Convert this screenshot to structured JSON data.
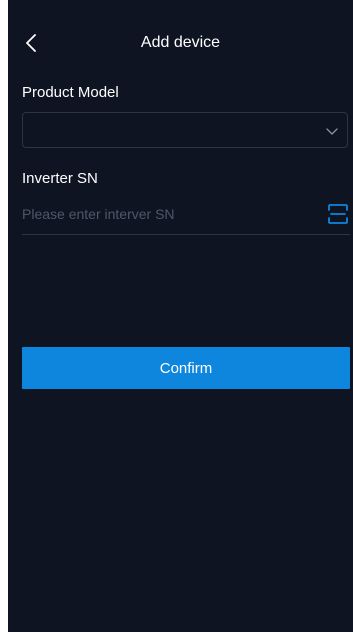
{
  "status_bar": {
    "carrier": "",
    "time": "",
    "battery": ""
  },
  "header": {
    "title": "Add device",
    "back_icon": "chevron-left-icon"
  },
  "form": {
    "product_model": {
      "label": "Product Model",
      "value": "",
      "dropdown_icon": "chevron-down-icon"
    },
    "inverter_sn": {
      "label": "Inverter SN",
      "value": "",
      "placeholder": "Please enter interver SN",
      "scan_icon": "scan-icon"
    },
    "confirm_label": "Confirm"
  },
  "colors": {
    "background": "#0f1422",
    "accent": "#0f86dd",
    "border": "#2d3446",
    "placeholder": "#4f5668"
  }
}
